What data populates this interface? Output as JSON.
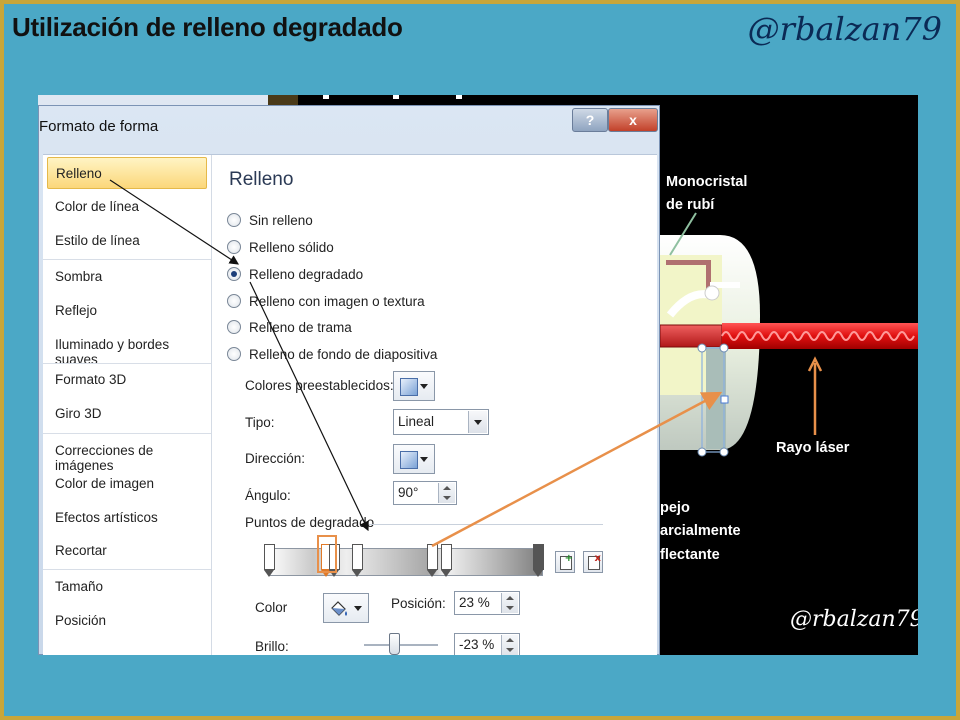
{
  "slide": {
    "title": "Utilización de relleno degradado",
    "handle": "@rbalzan79"
  },
  "dialog": {
    "title": "Formato de forma",
    "help_label": "?",
    "close_label": "x"
  },
  "sidebar": {
    "items": [
      {
        "label": "Relleno"
      },
      {
        "label": "Color de línea"
      },
      {
        "label": "Estilo de línea"
      },
      {
        "label": "Sombra"
      },
      {
        "label": "Reflejo"
      },
      {
        "label": "Iluminado y bordes suaves"
      },
      {
        "label": "Formato 3D"
      },
      {
        "label": "Giro 3D"
      },
      {
        "label": "Correcciones de imágenes"
      },
      {
        "label": "Color de imagen"
      },
      {
        "label": "Efectos artísticos"
      },
      {
        "label": "Recortar"
      },
      {
        "label": "Tamaño"
      },
      {
        "label": "Posición"
      }
    ]
  },
  "panel": {
    "title": "Relleno",
    "options": [
      {
        "label": "Sin relleno",
        "selected": false
      },
      {
        "label": "Relleno sólido",
        "selected": false
      },
      {
        "label": "Relleno degradado",
        "selected": true
      },
      {
        "label": "Relleno con imagen o textura",
        "selected": false
      },
      {
        "label": "Relleno de trama",
        "selected": false
      },
      {
        "label": "Relleno de fondo de diapositiva",
        "selected": false
      }
    ],
    "preset_label": "Colores preestablecidos:",
    "type_label": "Tipo:",
    "type_value": "Lineal",
    "direction_label": "Dirección:",
    "angle_label": "Ángulo:",
    "angle_value": "90°",
    "stops_label": "Puntos de degradado",
    "color_label": "Color",
    "position_label": "Posición:",
    "position_value": "23 %",
    "brightness_label": "Brillo:",
    "brightness_value": "-23 %"
  },
  "image": {
    "label_crystal_1": "Monocristal",
    "label_crystal_2": "de rubí",
    "label_laser": "Rayo láser",
    "label_mirror_1": "pejo",
    "label_mirror_2": "arcialmente",
    "label_mirror_3": "flectante",
    "watermark": "@rbalzan79"
  },
  "colors": {
    "slide_background": "#4ba8c6",
    "frame_border": "#c9a63a",
    "selected_item": "#fbd77a",
    "arrow_orange": "#e8904a",
    "laser_red": "#e01818"
  }
}
